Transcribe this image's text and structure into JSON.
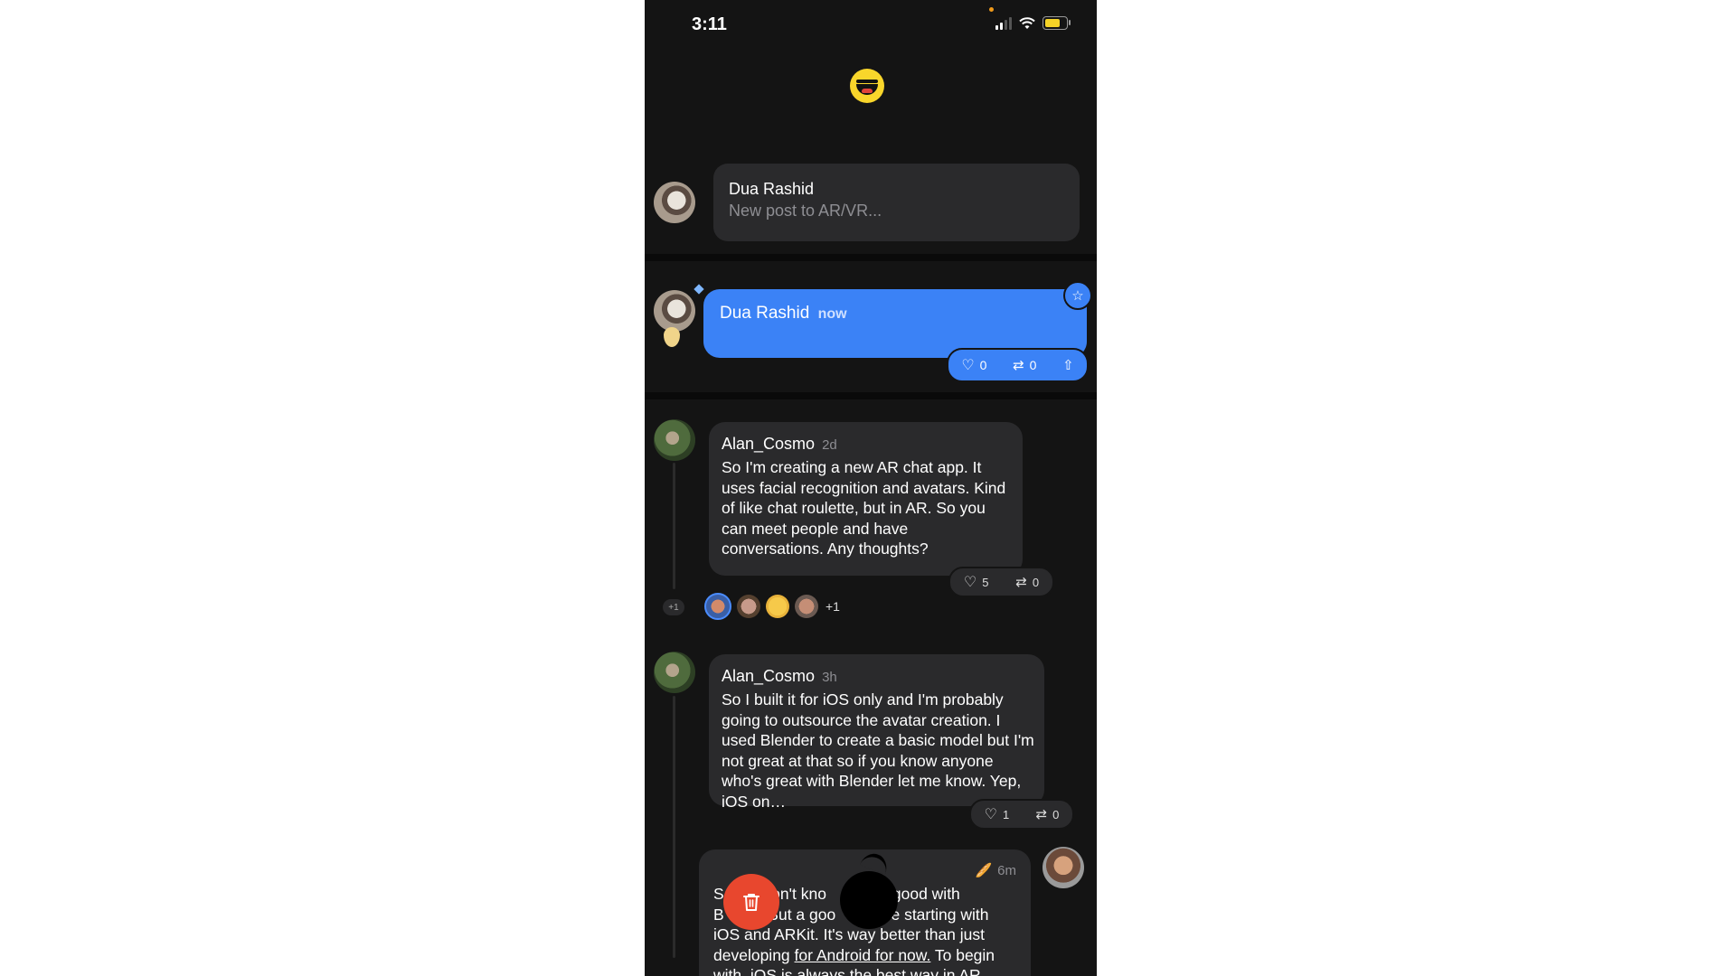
{
  "status_bar": {
    "time": "3:11"
  },
  "compose": {
    "name": "Dua Rashid",
    "placeholder": "New post to AR/VR..."
  },
  "live_post": {
    "name": "Dua Rashid",
    "time": "now",
    "likes": "0",
    "reposts": "0"
  },
  "posts": [
    {
      "author": "Alan_Cosmo",
      "ago": "2d",
      "body": "So I'm creating a new AR chat app. It uses facial recognition and avatars. Kind of like chat roulette, but in AR. So you can meet people and have conversations. Any thoughts?",
      "likes": "5",
      "reposts": "0",
      "reactors_more": "+1",
      "side_count": "+1"
    },
    {
      "author": "Alan_Cosmo",
      "ago": "3h",
      "body": "So I built it for iOS only and I'm probably going to outsource the avatar creation. I used Blender to create a basic model but I'm not great at that so if you know anyone who's great with Blender let me know. Yep, iOS on…",
      "likes": "1",
      "reposts": "0"
    }
  ],
  "draft": {
    "ago": "6m",
    "emoji": "🥖",
    "line1": "S          lon't kno          ne good with",
    "line2": "B          But a goo          ice starting with",
    "line3": "iOS and ARKit. It's way better than just",
    "line4_a": "developing ",
    "line4_b": "for Android for now.",
    "line4_c": " To begin",
    "line5": "with, iOS is always the best way in AR"
  },
  "icons": {
    "heart": "♡",
    "repost": "⇄",
    "share": "⇧",
    "star": "☆",
    "trash": "🗑"
  },
  "colors": {
    "accent_blue": "#3b82f6",
    "delete_red": "#e8472e",
    "bubble": "#2a2a2c",
    "background": "#141414"
  }
}
